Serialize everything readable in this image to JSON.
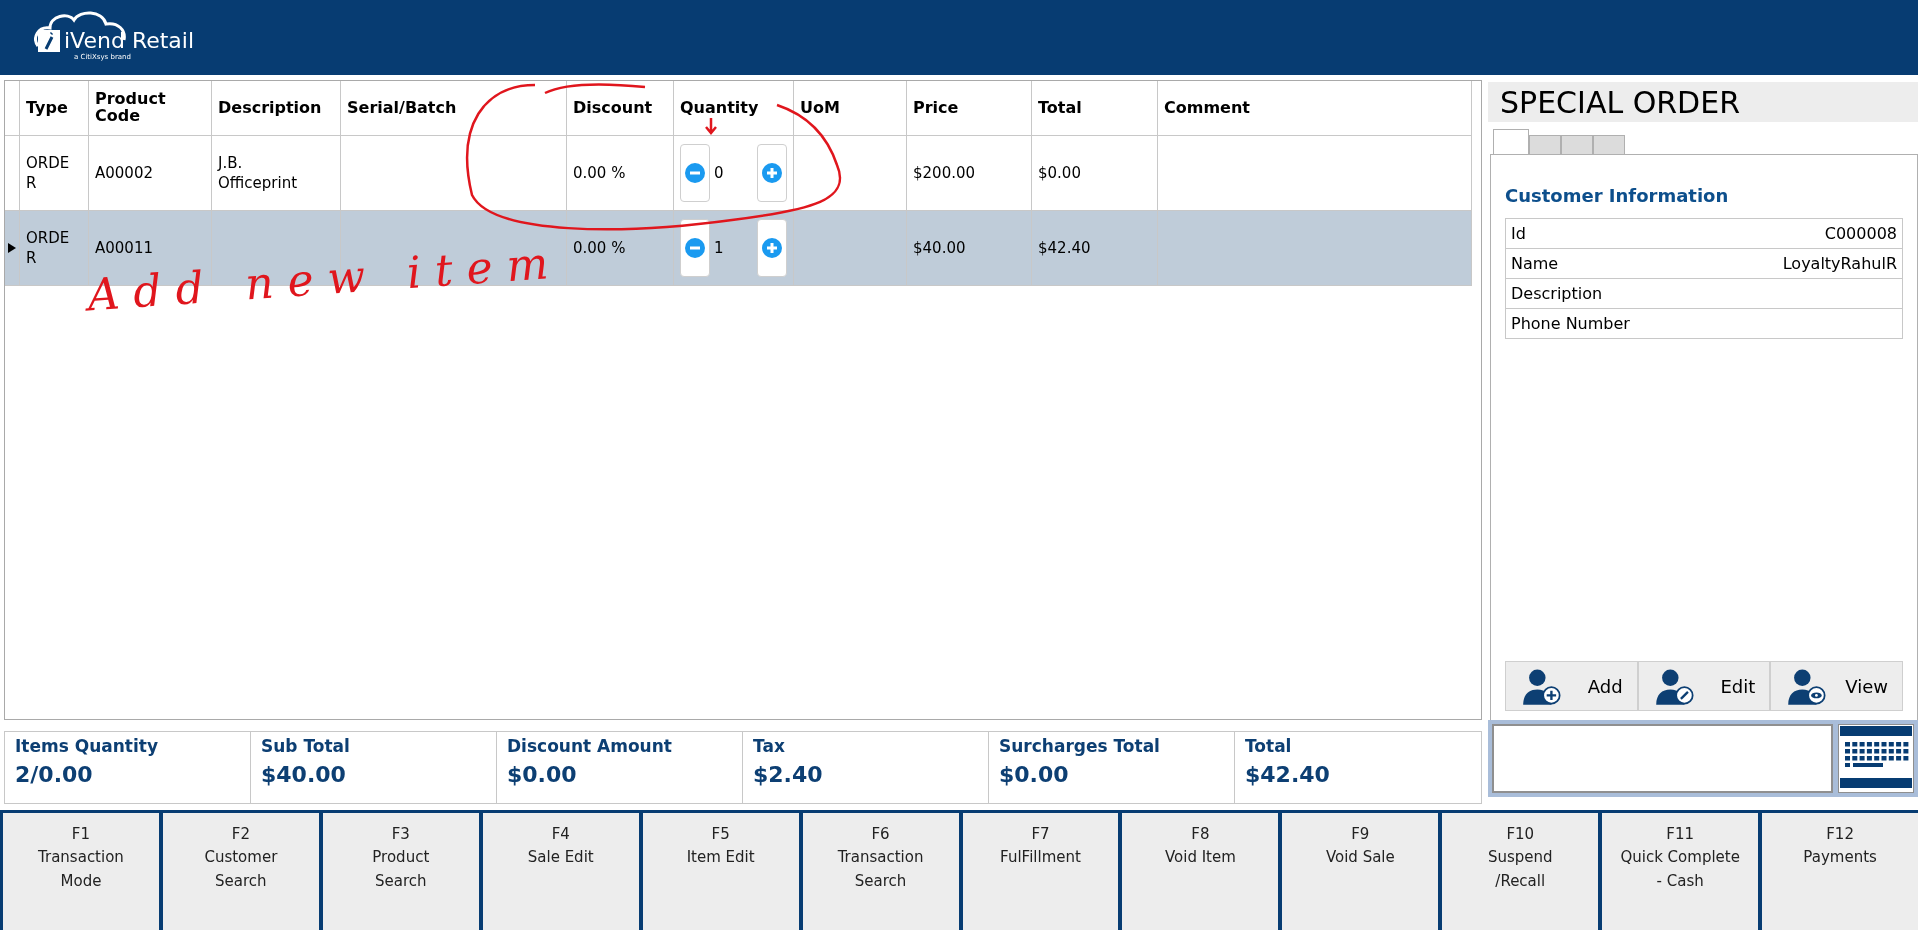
{
  "header": {
    "brand": "iVend Retail",
    "tagline": "a CitiXsys brand"
  },
  "grid": {
    "columns": [
      "Type",
      "Product Code",
      "Description",
      "Serial/Batch",
      "Discount",
      "Quantity",
      "UoM",
      "Price",
      "Total",
      "Comment"
    ],
    "rows": [
      {
        "selected": false,
        "type": "ORDE\nR",
        "product_code": "A00002",
        "description": "J.B.\nOfficeprint",
        "discount": "0.00 %",
        "quantity": "0",
        "price": "$200.00",
        "total": "$0.00"
      },
      {
        "selected": true,
        "type": "ORDE\nR",
        "product_code": "A00011",
        "description": "",
        "discount": "0.00 %",
        "quantity": "1",
        "price": "$40.00",
        "total": "$42.40"
      }
    ]
  },
  "annotation": {
    "note": "Add new item"
  },
  "side_panel": {
    "title": "SPECIAL ORDER",
    "tabs": [
      {
        "selected": true
      },
      {
        "selected": false
      },
      {
        "selected": false
      },
      {
        "selected": false
      }
    ],
    "section_title": "Customer Information",
    "fields": [
      {
        "label": "Id",
        "value": "C000008"
      },
      {
        "label": "Name",
        "value": "LoyaltyRahulR"
      },
      {
        "label": "Description"
      },
      {
        "label": "Phone Number"
      }
    ],
    "buttons": [
      {
        "kind": "add",
        "label": "Add"
      },
      {
        "kind": "edit",
        "label": "Edit"
      },
      {
        "kind": "view",
        "label": "View"
      }
    ]
  },
  "totals": [
    {
      "label": "Items Quantity",
      "value": "2/0.00"
    },
    {
      "label": "Sub Total",
      "value": "$40.00"
    },
    {
      "label": "Discount Amount",
      "value": "$0.00"
    },
    {
      "label": "Tax",
      "value": "$2.40"
    },
    {
      "label": "Surcharges Total",
      "value": "$0.00"
    },
    {
      "label": "Total",
      "value": "$42.40"
    }
  ],
  "function_keys": [
    {
      "key": "F1",
      "label": "Transaction\nMode"
    },
    {
      "key": "F2",
      "label": "Customer\nSearch"
    },
    {
      "key": "F3",
      "label": "Product\nSearch"
    },
    {
      "key": "F4",
      "label": "Sale Edit"
    },
    {
      "key": "F5",
      "label": "Item Edit"
    },
    {
      "key": "F6",
      "label": "Transaction\nSearch"
    },
    {
      "key": "F7",
      "label": "FulFillment"
    },
    {
      "key": "F8",
      "label": "Void Item"
    },
    {
      "key": "F9",
      "label": "Void Sale"
    },
    {
      "key": "F10",
      "label": "Suspend\n/Recall"
    },
    {
      "key": "F11",
      "label": "Quick Complete\n- Cash"
    },
    {
      "key": "F12",
      "label": "Payments"
    }
  ]
}
